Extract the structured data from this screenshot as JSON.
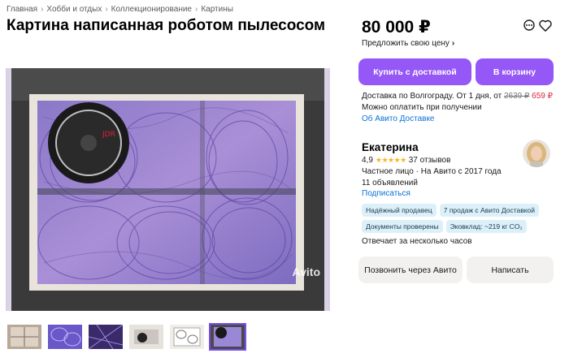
{
  "breadcrumb": [
    "Главная",
    "Хобби и отдых",
    "Коллекционирование",
    "Картины"
  ],
  "title": "Картина написанная роботом пылесосом",
  "gallery": {
    "watermark": "Avito",
    "thumbnail_count": 6,
    "active_thumbnail": 6
  },
  "price": {
    "value": "80 000 ₽",
    "offer_label": "Предложить свою цену"
  },
  "buttons": {
    "buy_delivery": "Купить с доставкой",
    "to_cart": "В корзину",
    "call": "Позвонить через Авито",
    "write": "Написать"
  },
  "delivery": {
    "line1_prefix": "Доставка по Волгограду. От 1 дня, от",
    "old_price": "2639 ₽",
    "new_price": "659 ₽",
    "line2": "Можно оплатить при получении",
    "link": "Об Авито Доставке"
  },
  "seller": {
    "name": "Екатерина",
    "rating": "4,9",
    "stars": "★★★★★",
    "reviews": "37 отзывов",
    "type_since": "Частное лицо · На Авито с 2017 года",
    "listings": "11 объявлений",
    "subscribe": "Подписаться"
  },
  "badges": [
    "Надёжный продавец",
    "7 продаж с Авито Доставкой",
    "Документы проверены",
    "Эковклад: ~219 кг CO₂"
  ],
  "reply_time": "Отвечает за несколько часов",
  "colors": {
    "accent": "#9657f7",
    "link": "#0a73d8",
    "sale": "#e0243a",
    "badge_bg": "#dcf0fa"
  }
}
